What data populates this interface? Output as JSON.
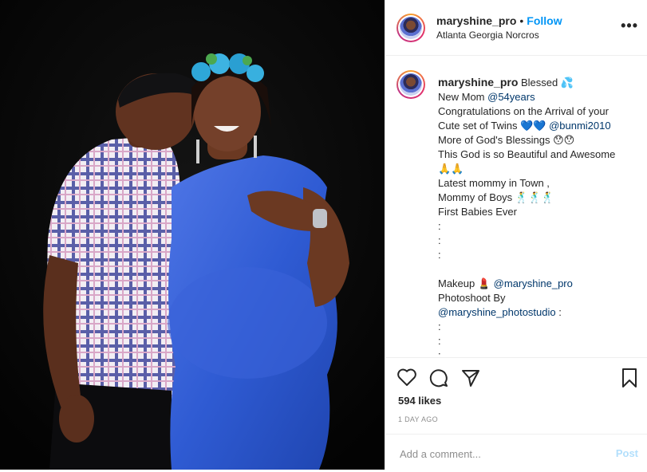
{
  "post": {
    "username": "maryshine_pro",
    "separator": "•",
    "follow_label": "Follow",
    "location": "Atlanta Georgia Norcros",
    "more_label": "•••"
  },
  "caption": {
    "username": "maryshine_pro",
    "lines": [
      {
        "text": "Blessed 💦"
      },
      {
        "pre": "New Mom ",
        "mention": "@54years"
      },
      {
        "text": "Congratulations on the Arrival of your"
      },
      {
        "pre": "Cute set of Twins 💙💙 ",
        "mention": "@bunmi2010"
      },
      {
        "text": "More of God's Blessings 😯😯"
      },
      {
        "text": "This God is so Beautiful and Awesome"
      },
      {
        "text": "🙏🙏"
      },
      {
        "text": "Latest mommy in Town ,"
      },
      {
        "text": "Mommy of Boys 🕺🕺🕺"
      },
      {
        "text": "First Babies Ever"
      },
      {
        "text": ":"
      },
      {
        "text": ":"
      },
      {
        "text": ":"
      },
      {
        "text": ""
      },
      {
        "pre": "Makeup 💄 ",
        "mention": "@maryshine_pro"
      },
      {
        "text": "Photoshoot By"
      },
      {
        "mention": "@maryshine_photostudio",
        "post": " :"
      },
      {
        "text": ":"
      },
      {
        "text": ":"
      },
      {
        "text": ":"
      },
      {
        "text": ":"
      }
    ]
  },
  "stats": {
    "likes": "594 likes",
    "time": "1 DAY AGO"
  },
  "comment": {
    "placeholder": "Add a comment...",
    "post_label": "Post"
  },
  "icons": {
    "like": "heart-icon",
    "comment": "comment-icon",
    "share": "share-icon",
    "save": "bookmark-icon"
  }
}
